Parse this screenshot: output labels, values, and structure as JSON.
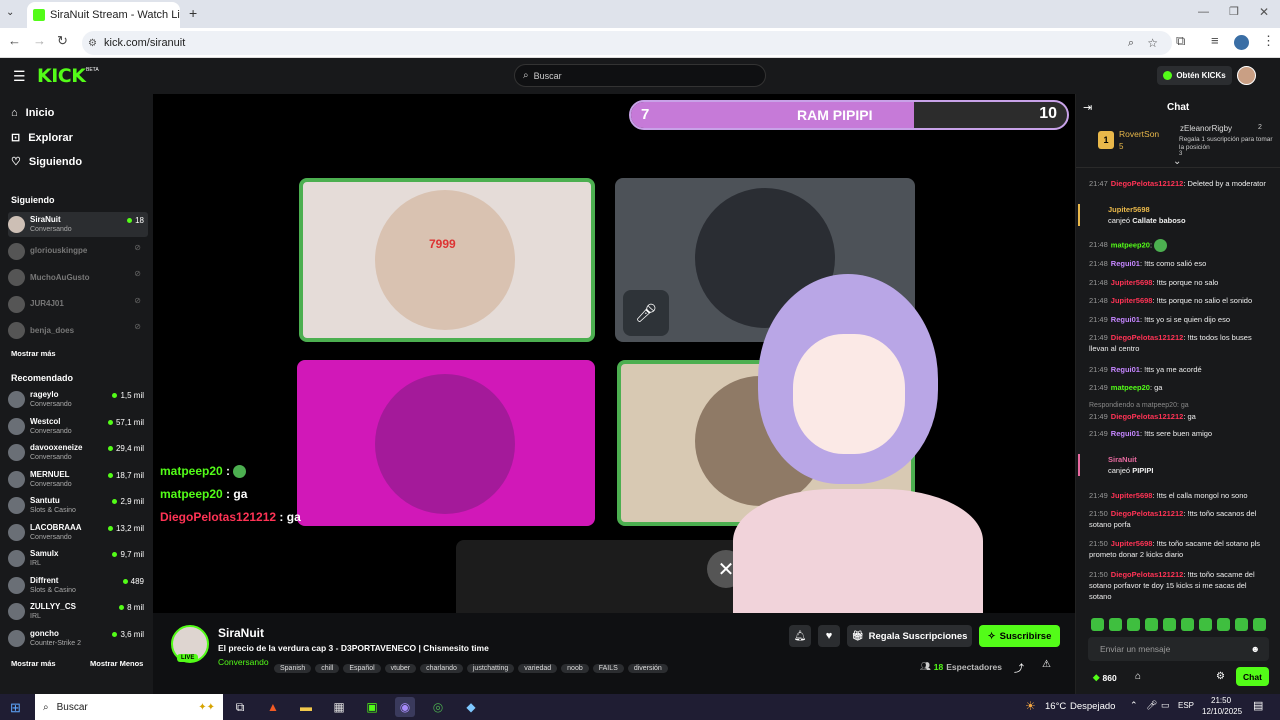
{
  "browser": {
    "tab_title": "SiraNuit Stream - Watch Live o",
    "url": "kick.com/siranuit"
  },
  "topnav": {
    "logo": "KICK",
    "logo_badge": "BETA",
    "search_placeholder": "Buscar",
    "kicks_button": "Obtén KICKs"
  },
  "leftnav": {
    "nav_items": [
      {
        "label": "Inicio",
        "icon": "home-icon"
      },
      {
        "label": "Explorar",
        "icon": "compass-icon"
      },
      {
        "label": "Siguiendo",
        "icon": "heart-icon"
      }
    ],
    "following_header": "Siguiendo",
    "following": [
      {
        "name": "SiraNuit",
        "category": "Conversando",
        "viewers": "18",
        "live": true
      },
      {
        "name": "gloriouskingpe",
        "category": "",
        "viewers": "",
        "live": false
      },
      {
        "name": "MuchoAuGusto",
        "category": "",
        "viewers": "",
        "live": false
      },
      {
        "name": "JUR4J01",
        "category": "",
        "viewers": "",
        "live": false
      },
      {
        "name": "benja_does",
        "category": "",
        "viewers": "",
        "live": false
      }
    ],
    "show_more": "Mostrar más",
    "recommended_header": "Recomendado",
    "recommended": [
      {
        "name": "rageylo",
        "category": "Conversando",
        "viewers": "1,5 mil"
      },
      {
        "name": "Westcol",
        "category": "Conversando",
        "viewers": "57,1 mil"
      },
      {
        "name": "davooxeneize",
        "category": "Conversando",
        "viewers": "29,4 mil"
      },
      {
        "name": "MERNUEL",
        "category": "Conversando",
        "viewers": "18,7 mil"
      },
      {
        "name": "Santutu",
        "category": "Slots & Casino",
        "viewers": "2,9 mil"
      },
      {
        "name": "LACOBRAAA",
        "category": "Conversando",
        "viewers": "13,2 mil"
      },
      {
        "name": "Samulx",
        "category": "IRL",
        "viewers": "9,7 mil"
      },
      {
        "name": "Diffrent",
        "category": "Slots & Casino",
        "viewers": "489"
      },
      {
        "name": "ZULLYY_CS",
        "category": "IRL",
        "viewers": "8 mil"
      },
      {
        "name": "goncho",
        "category": "Counter-Strike 2",
        "viewers": "3,6 mil"
      }
    ],
    "show_more_2": "Mostrar más",
    "show_less": "Mostrar Menos"
  },
  "video": {
    "banner_left": "7",
    "banner_title": "RAM PIPIPI",
    "banner_right": "10",
    "banner_progress": 0.65,
    "overlay_chat": [
      {
        "user": "matpeep20",
        "text": ":",
        "emote": true,
        "color": "#53fc18"
      },
      {
        "user": "matpeep20",
        "text": ": ga",
        "emote": false,
        "color": "#53fc18"
      },
      {
        "user": "DiegoPelotas121212",
        "text": ": ga",
        "emote": false,
        "color": "#ff3355"
      }
    ],
    "cam1_text": "7999"
  },
  "stream_info": {
    "channel": "SiraNuit",
    "live_badge": "LIVE",
    "title": "El precio de la verdura cap 3 - D3PORTAVENECO | Chismesito time",
    "category": "Conversando",
    "tags": [
      "Spanish",
      "chill",
      "Español",
      "vtuber",
      "charlando",
      "justchatting",
      "variedad",
      "noob",
      "FAILS",
      "diversión"
    ],
    "gift_button": "Regala Suscripciones",
    "subscribe_button": "Suscribirse",
    "viewers": "18",
    "viewers_label": "Espectadores"
  },
  "chat": {
    "header": "Chat",
    "pinned_rank": "1",
    "pinned_user": "RovertSon",
    "pinned_count": "5",
    "gift_user": "zEleanorRigby",
    "gift_count": "2",
    "gift_text": "Regala 1 suscripción para tomar la posición",
    "gift_rank": "3",
    "messages": [
      {
        "time": "21:47",
        "user": "DiegoPelotas121212",
        "color": "#ff3355",
        "text": ": Deleted by a moderator"
      },
      {
        "type": "redeem",
        "user": "Jupiter5698",
        "color": "#e9b84a",
        "prefix": "canjeó",
        "reward": "Callate baboso"
      },
      {
        "time": "21:48",
        "user": "matpeep20",
        "color": "#53fc18",
        "text": ":",
        "emote": true
      },
      {
        "time": "21:48",
        "user": "Regui01",
        "color": "#c586ff",
        "text": ": !tts como salió eso"
      },
      {
        "time": "21:48",
        "user": "Jupiter5698",
        "color": "#ff3355",
        "text": ": !tts porque no salo"
      },
      {
        "time": "21:48",
        "user": "Jupiter5698",
        "color": "#ff3355",
        "text": ": !tts porque no salio el sonido"
      },
      {
        "time": "21:49",
        "user": "Regui01",
        "color": "#c586ff",
        "text": ": !tts yo si se quien dijo eso"
      },
      {
        "time": "21:49",
        "user": "DiegoPelotas121212",
        "color": "#ff3355",
        "text": ": !tts todos los buses llevan al centro"
      },
      {
        "time": "21:49",
        "user": "Regui01",
        "color": "#c586ff",
        "text": ": !tts ya me acordé"
      },
      {
        "time": "21:49",
        "user": "matpeep20",
        "color": "#53fc18",
        "text": ": ga"
      },
      {
        "type": "reply",
        "reply_to": "Respondiendo a matpeep20: ga",
        "time": "21:49",
        "user": "DiegoPelotas121212",
        "color": "#ff3355",
        "text": ": ga"
      },
      {
        "time": "21:49",
        "user": "Regui01",
        "color": "#c586ff",
        "text": ": !tts sere buen amigo"
      },
      {
        "type": "redeem",
        "user": "SiraNuit",
        "color": "#e86aa0",
        "prefix": "canjeó",
        "reward": "PIPIPI"
      },
      {
        "time": "21:49",
        "user": "Jupiter5698",
        "color": "#ff3355",
        "text": ": !tts el calla mongol no sono"
      },
      {
        "time": "21:50",
        "user": "DiegoPelotas121212",
        "color": "#ff3355",
        "text": ": !tts toño sacanos del sotano porfa"
      },
      {
        "time": "21:50",
        "user": "Jupiter5698",
        "color": "#ff3355",
        "text": ": !tts toño sacame del sotano pls prometo donar 2 kicks diario"
      },
      {
        "time": "21:50",
        "user": "DiegoPelotas121212",
        "color": "#ff3355",
        "text": ": !tts toño sacame del sotano porfavor te doy 15 kicks si me sacas del sotano"
      }
    ],
    "input_placeholder": "Enviar un mensaje",
    "kicks_count": "860",
    "send_button": "Chat"
  },
  "taskbar": {
    "search": "Buscar",
    "weather": "16°C",
    "weather_text": "Despejado",
    "lang": "ESP",
    "time": "21:50",
    "date": "12/10/2025"
  },
  "colors": {
    "accent": "#53fc18",
    "background": "#0b0e0f",
    "panel": "#18191b"
  }
}
